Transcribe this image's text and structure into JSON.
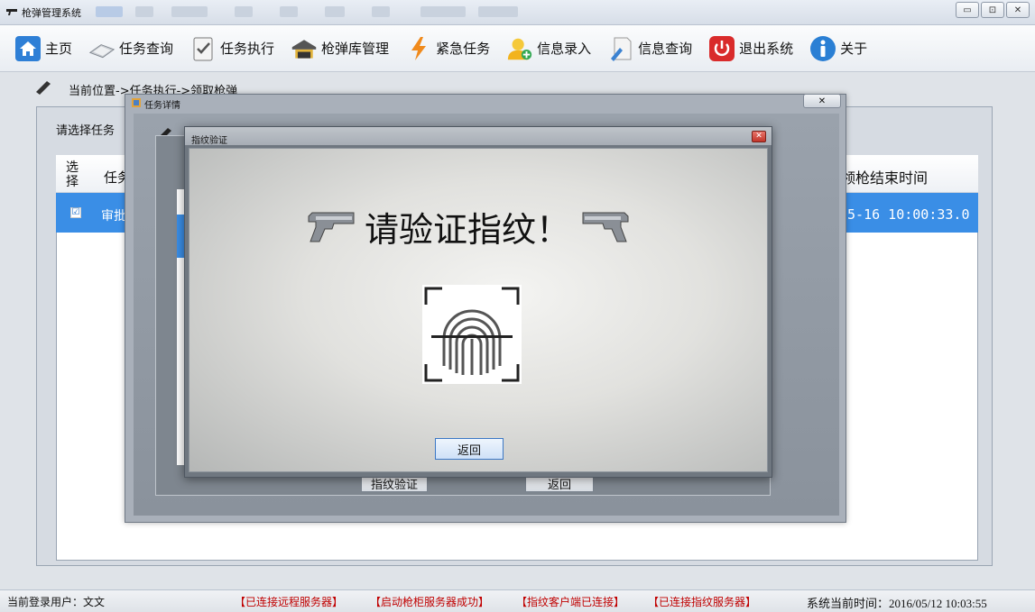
{
  "window": {
    "title": "枪弹管理系统",
    "controls": {
      "minimize": "▭",
      "maximize": "⊡",
      "close": "✕"
    }
  },
  "toolbar": {
    "items": [
      {
        "label": "主页",
        "icon": "home-icon"
      },
      {
        "label": "任务查询",
        "icon": "task-search-icon"
      },
      {
        "label": "任务执行",
        "icon": "task-execute-icon"
      },
      {
        "label": "枪弹库管理",
        "icon": "armory-icon"
      },
      {
        "label": "紧急任务",
        "icon": "lightning-icon"
      },
      {
        "label": "信息录入",
        "icon": "user-add-icon"
      },
      {
        "label": "信息查询",
        "icon": "document-search-icon"
      },
      {
        "label": "退出系统",
        "icon": "power-icon"
      },
      {
        "label": "关于",
        "icon": "info-icon"
      }
    ]
  },
  "main": {
    "location": "当前位置->任务执行->领取枪弹",
    "select_task_label": "请选择任务",
    "table": {
      "header_select": "选择",
      "header_task": "任务",
      "header_end_time": "领枪结束时间",
      "row": {
        "checked": "☑",
        "task": "审批",
        "end_time": "05-16 10:00:33.0"
      }
    }
  },
  "task_dialog": {
    "title": "任务详情",
    "close": "✕",
    "btn_fingerprint": "指纹验证",
    "btn_back": "返回"
  },
  "fingerprint_dialog": {
    "title": "指纹验证",
    "close": "✕",
    "heading": "请验证指纹！",
    "back_button": "返回"
  },
  "status": {
    "user": "当前登录用户：文文",
    "messages": [
      "【已连接远程服务器】",
      "【启动枪柜服务器成功】",
      "【指纹客户端已连接】",
      "【已连接指纹服务器】"
    ],
    "time": "系统当前时间：2016/05/12 10:03:55"
  },
  "colors": {
    "selection_blue": "#3a8ee6",
    "status_red": "#c00000",
    "accent_blue": "#1e6ec8"
  }
}
